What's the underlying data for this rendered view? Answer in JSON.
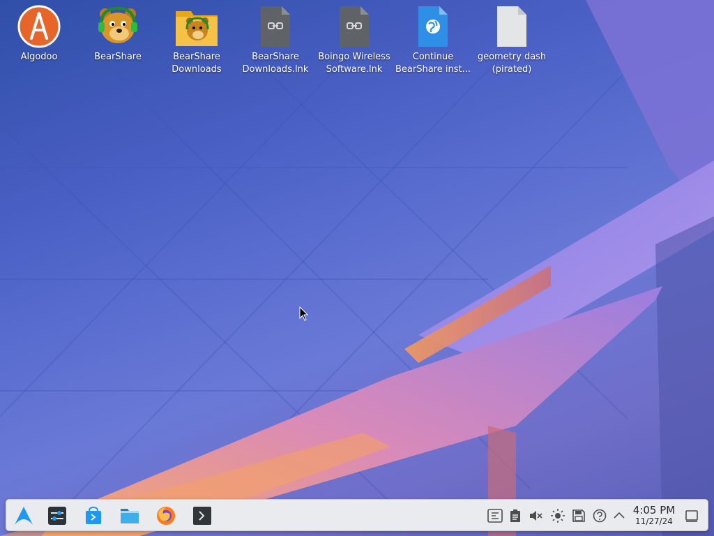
{
  "desktop": {
    "icons": [
      {
        "label": "Algodoo",
        "icon": "algodoo-icon"
      },
      {
        "label": "BearShare",
        "icon": "bearshare-bear-icon"
      },
      {
        "label": "BearShare\nDownloads",
        "icon": "bearshare-folder-icon"
      },
      {
        "label": "BearShare\nDownloads.lnk",
        "icon": "shortcut-file-icon"
      },
      {
        "label": "Boingo Wireless\nSoftware.lnk",
        "icon": "shortcut-file-icon"
      },
      {
        "label": "Continue\nBearShare inst...",
        "icon": "web-link-file-icon"
      },
      {
        "label": "geometry dash\n(pirated)",
        "icon": "blank-file-icon"
      }
    ]
  },
  "taskbar": {
    "launchers": [
      {
        "icon": "application-launcher-icon"
      },
      {
        "icon": "system-settings-icon"
      },
      {
        "icon": "discover-store-icon"
      },
      {
        "icon": "file-manager-icon"
      },
      {
        "icon": "firefox-icon"
      },
      {
        "icon": "terminal-icon"
      }
    ],
    "tray": [
      {
        "icon": "kde-connect-icon"
      },
      {
        "icon": "clipboard-icon"
      },
      {
        "icon": "volume-muted-icon"
      },
      {
        "icon": "brightness-icon"
      },
      {
        "icon": "disks-devices-icon"
      },
      {
        "icon": "help-icon"
      },
      {
        "icon": "show-hidden-icons-chevron-up-icon"
      }
    ],
    "clock": {
      "time": "4:05 PM",
      "date": "11/27/24"
    },
    "show_desktop": {
      "icon": "show-desktop-icon"
    }
  },
  "colors": {
    "taskbar_bg": "#e9ebef",
    "accent_blue": "#1d99f3",
    "icon_text": "#ffffff"
  }
}
